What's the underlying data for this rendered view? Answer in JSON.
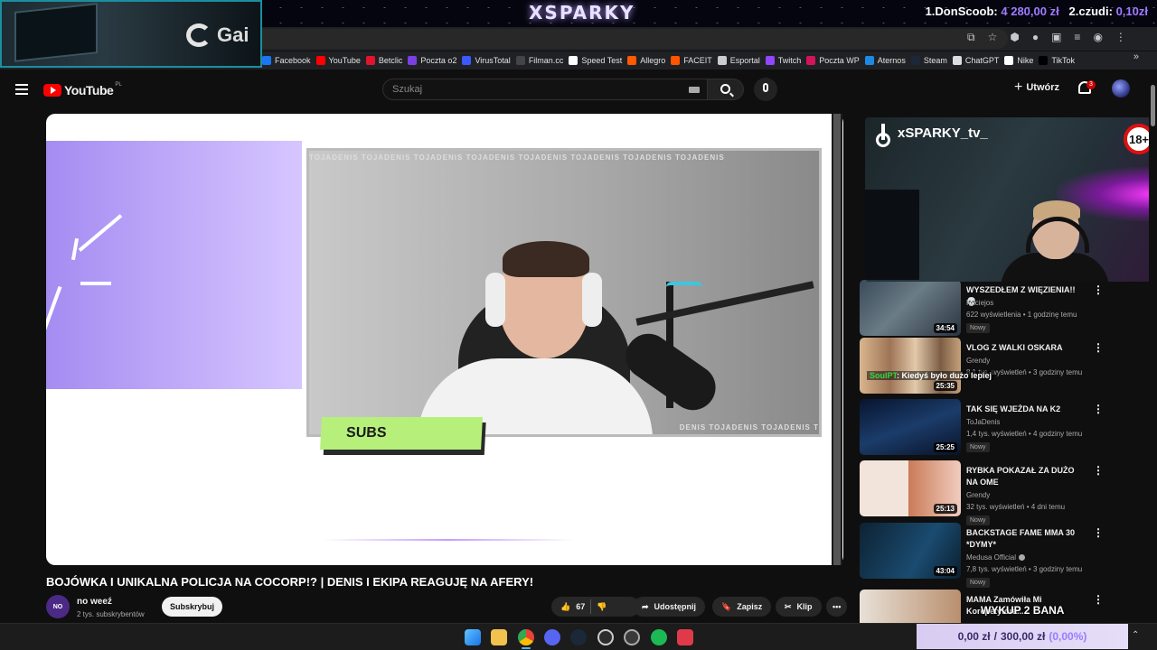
{
  "overlay": {
    "brand": "XSPARKY",
    "donor1_label": "1.DonScoob:",
    "donor1_amount": "4 280,00 zł",
    "donor2_label": "2.czudi:",
    "donor2_amount": "0,10zł",
    "cam_logo_text": "Gai"
  },
  "bookmarks": [
    {
      "label": "Facebook",
      "color": "#1877f2"
    },
    {
      "label": "YouTube",
      "color": "#ff0000"
    },
    {
      "label": "Betclic",
      "color": "#e0142c"
    },
    {
      "label": "Poczta o2",
      "color": "#7b3fe4"
    },
    {
      "label": "VirusTotal",
      "color": "#3a59ff"
    },
    {
      "label": "Filman.cc",
      "color": "#444444"
    },
    {
      "label": "Speed Test",
      "color": "#ffffff"
    },
    {
      "label": "Allegro",
      "color": "#ff5a00"
    },
    {
      "label": "FACEIT",
      "color": "#ff5500"
    },
    {
      "label": "Esportal",
      "color": "#cccccc"
    },
    {
      "label": "Twitch",
      "color": "#9146ff"
    },
    {
      "label": "Poczta WP",
      "color": "#d4145a"
    },
    {
      "label": "Aternos",
      "color": "#1e88e5"
    },
    {
      "label": "Steam",
      "color": "#1b2838"
    },
    {
      "label": "ChatGPT",
      "color": "#dddddd"
    },
    {
      "label": "Nike",
      "color": "#ffffff"
    },
    {
      "label": "TikTok",
      "color": "#000000"
    }
  ],
  "header": {
    "logo_text": "YouTube",
    "country": "PL",
    "search_placeholder": "Szukaj",
    "create_label": "Utwórz",
    "notifications": "3"
  },
  "player": {
    "cam_strip_top": "TOJADENIS   TOJADENIS   TOJADENIS   TOJADENIS   TOJADENIS   TOJADENIS   TOJADENIS   TOJADENIS",
    "cam_strip_bottom": "DENIS   TOJADENIS   TOJADENIS   T",
    "subs_label": "SUBS"
  },
  "video": {
    "title": "BOJÓWKA I UNIKALNA POLICJA NA COCORP!? | DENIS I EKIPA REAGUJĘ NA AFERY!",
    "channel": "no weeź",
    "channel_avatar": "NO",
    "subscribers": "2 tys. subskrybentów",
    "subscribe_label": "Subskrybuj",
    "likes": "67",
    "share_label": "Udostępnij",
    "save_label": "Zapisz",
    "clip_label": "Klip"
  },
  "tiktok": {
    "handle": "xSPARKY_tv_",
    "age_badge": "18+"
  },
  "chat": {
    "user": "SoulPT",
    "message": ": Kiedyś było dużo lepiej"
  },
  "recommendations": [
    {
      "title": "WYSZEDŁEM Z WIĘZIENIA!! 💀",
      "channel": "Kaciejos",
      "meta": "622 wyświetlenia • 1 godzinę temu",
      "badge": "Nowy",
      "duration": "34:54"
    },
    {
      "title": "VLOG Z WALKI OSKARA",
      "channel": "Grendy",
      "meta": "8,1 tys. wyświetleń • 3 godziny temu",
      "badge": "",
      "duration": "25:35"
    },
    {
      "title": "TAK SIĘ WJEŻDA NA K2",
      "channel": "ToJaDenis",
      "meta": "1,4 tys. wyświetleń • 4 godziny temu",
      "badge": "Nowy",
      "duration": "25:25"
    },
    {
      "title": "RYBKA POKAZAŁ ZA DUŻO NA OME",
      "channel": "Grendy",
      "meta": "32 tys. wyświetleń • 4 dni temu",
      "badge": "Nowy",
      "duration": "25:13"
    },
    {
      "title": "BACKSTAGE FAME MMA 30 *DYMY*",
      "channel": "Medusa Official",
      "meta": "7,8 tys. wyświetleń • 3 godziny temu",
      "badge": "Nowy",
      "duration": "43:04"
    },
    {
      "title": "MAMA Zamówiła Mi Korepetytora...",
      "channel": "",
      "meta": "",
      "badge": "",
      "duration": ""
    }
  ],
  "goal": {
    "current": "0,00 zł",
    "target": "300,00 zł",
    "percent": "(0,00%)",
    "caption": "WYKUP 2 BANA"
  }
}
